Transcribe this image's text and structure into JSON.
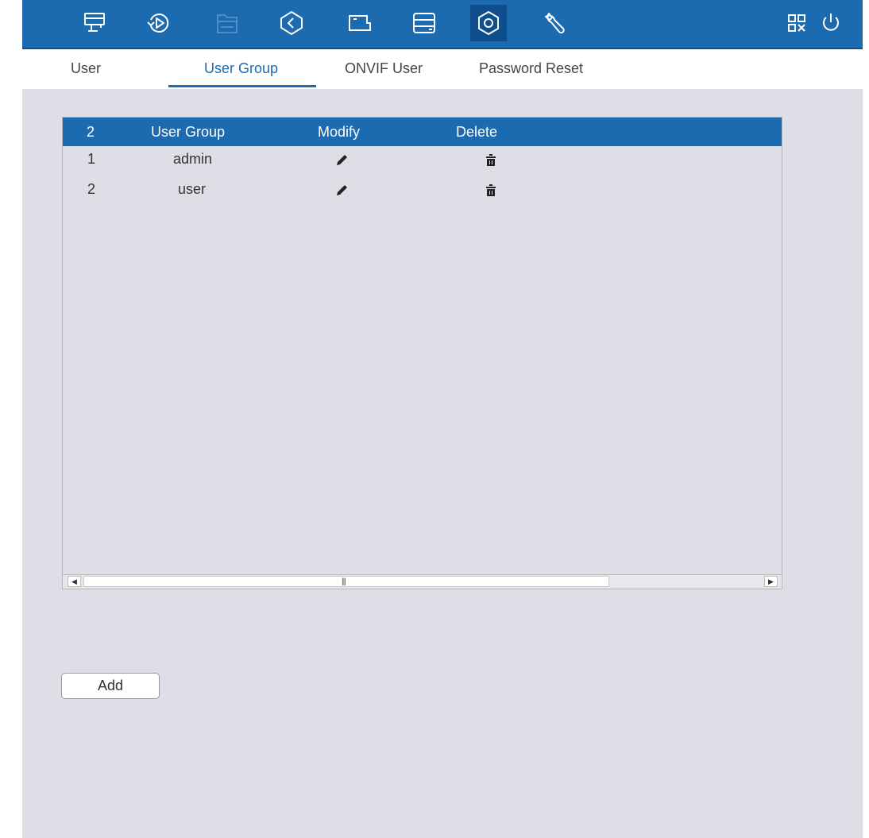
{
  "colors": {
    "accent": "#1c6ab0",
    "accent_dark": "#0e4e8c",
    "panel_bg": "#dedee6"
  },
  "topbar": {
    "icons": [
      {
        "name": "live-view-icon",
        "active": false,
        "dim": false
      },
      {
        "name": "playback-icon",
        "active": false,
        "dim": false
      },
      {
        "name": "file-search-icon",
        "active": false,
        "dim": true
      },
      {
        "name": "smart-search-icon",
        "active": false,
        "dim": false
      },
      {
        "name": "camera-icon",
        "active": false,
        "dim": false
      },
      {
        "name": "storage-icon",
        "active": false,
        "dim": false
      },
      {
        "name": "settings-gear-icon",
        "active": true,
        "dim": false
      },
      {
        "name": "maintenance-wrench-icon",
        "active": false,
        "dim": false
      },
      {
        "name": "qr-code-icon",
        "active": false,
        "dim": false
      },
      {
        "name": "power-icon",
        "active": false,
        "dim": false
      }
    ]
  },
  "tabs": [
    {
      "label": "User",
      "active": false
    },
    {
      "label": "User Group",
      "active": true
    },
    {
      "label": "ONVIF User",
      "active": false
    },
    {
      "label": "Password Reset",
      "active": false
    }
  ],
  "table": {
    "header": {
      "count": "2",
      "group": "User Group",
      "modify": "Modify",
      "delete": "Delete"
    },
    "rows": [
      {
        "index": "1",
        "group": "admin",
        "modify_icon": "pencil-icon",
        "delete_icon": "trash-icon"
      },
      {
        "index": "2",
        "group": "user",
        "modify_icon": "pencil-icon",
        "delete_icon": "trash-icon"
      }
    ]
  },
  "actions": {
    "add_label": "Add"
  }
}
